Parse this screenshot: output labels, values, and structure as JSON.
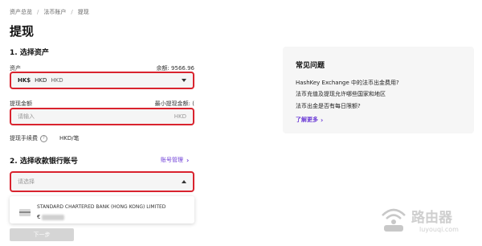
{
  "breadcrumb": [
    "资产总览",
    "法币账户",
    "提现"
  ],
  "page_title": "提现",
  "step1": {
    "title": "1. 选择资产",
    "asset_label": "资产",
    "balance_label": "余额: 9566.96",
    "asset_symbol": "HK$",
    "asset_code": "HKD",
    "asset_name": "HKD",
    "amount_label": "提现金额",
    "min_label": "最小提现金额: (",
    "amount_placeholder": "请输入",
    "amount_unit": "HKD",
    "fee_label": "提现手续费",
    "fee_value": "HKD/笔"
  },
  "step2": {
    "title": "2. 选择收款银行账号",
    "manage_link": "账号管理",
    "select_placeholder": "请选择",
    "bank_name": "STANDARD CHARTERED BANK (HONG KONG) LIMITED",
    "bank_account_prefix": "€"
  },
  "help": {
    "title": "常见问题",
    "questions": [
      "HashKey Exchange 中的法币出金费用?",
      "法币充值及提现允许哪些国家和地区",
      "法币出金是否有每日限额?"
    ],
    "more": "了解更多"
  },
  "next_button": "下一步",
  "watermark": "路由器",
  "watermark_url": "luyouqi.com",
  "colors": {
    "accent": "#6c3bd6",
    "highlight": "#d9232e",
    "field_bg": "#f5f5f5"
  }
}
